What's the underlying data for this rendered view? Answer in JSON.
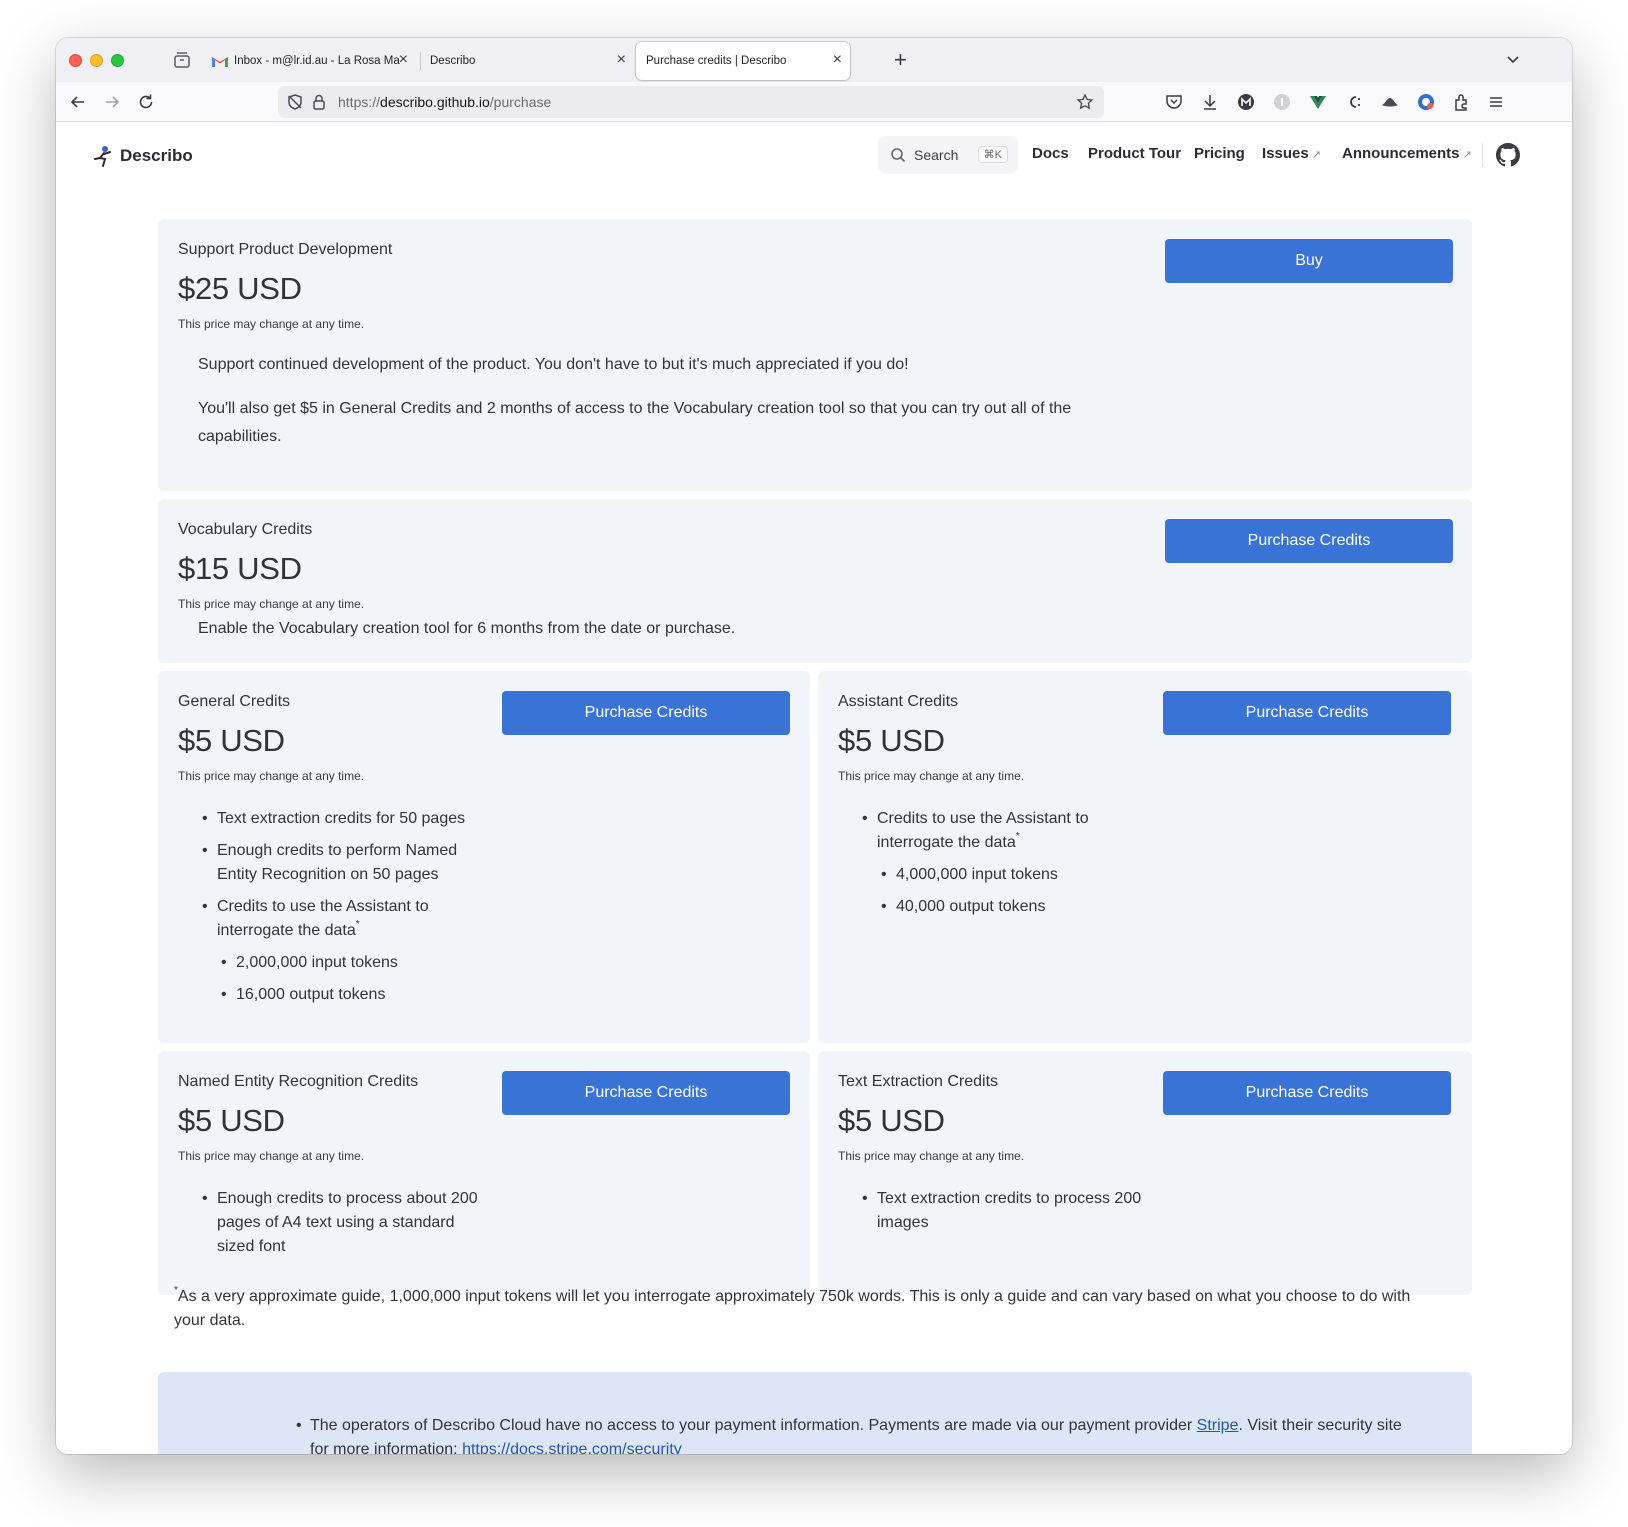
{
  "browser": {
    "tabs": [
      {
        "title": "Inbox - m@lr.id.au - La Rosa Ma",
        "active": false
      },
      {
        "title": "Describo",
        "active": false
      },
      {
        "title": "Purchase credits | Describo",
        "active": true
      }
    ],
    "url_host": "describo.github.io",
    "url_prefix": "https://",
    "url_path": "/purchase"
  },
  "site": {
    "name": "Describo",
    "search_label": "Search",
    "search_shortcut": "⌘K",
    "nav": [
      {
        "label": "Docs",
        "external": false
      },
      {
        "label": "Product Tour",
        "external": false
      },
      {
        "label": "Pricing",
        "external": false
      },
      {
        "label": "Issues",
        "external": true
      },
      {
        "label": "Announcements",
        "external": true
      }
    ],
    "external_mark": "↗"
  },
  "price_note": "This price may change at any time.",
  "products": {
    "support": {
      "label": "Support Product Development",
      "price": "$25 USD",
      "button": "Buy",
      "paragraphs": [
        "Support continued development of the product. You don't have to but it's much appreciated if you do!",
        "You'll also get $5 in General Credits and 2 months of access to the Vocabulary creation tool so that you can try out all of the capabilities."
      ]
    },
    "vocabulary": {
      "label": "Vocabulary Credits",
      "price": "$15 USD",
      "button": "Purchase Credits",
      "description": "Enable the Vocabulary creation tool for 6 months from the date or purchase."
    },
    "general": {
      "label": "General Credits",
      "price": "$5 USD",
      "button": "Purchase Credits",
      "bullets": [
        "Text extraction credits for 50 pages",
        "Enough credits to perform Named Entity Recognition on 50 pages",
        "Credits to use the Assistant to interrogate the data"
      ],
      "sub_bullets": [
        "2,000,000 input tokens",
        "16,000 output tokens"
      ]
    },
    "assistant": {
      "label": "Assistant Credits",
      "price": "$5 USD",
      "button": "Purchase Credits",
      "bullets": [
        "Credits to use the Assistant to interrogate the data"
      ],
      "sub_bullets": [
        "4,000,000 input tokens",
        "40,000 output tokens"
      ]
    },
    "ner": {
      "label": "Named Entity Recognition Credits",
      "price": "$5 USD",
      "button": "Purchase Credits",
      "bullets": [
        "Enough credits to process about 200 pages of A4 text using a standard sized font"
      ]
    },
    "text_extraction": {
      "label": "Text Extraction Credits",
      "price": "$5 USD",
      "button": "Purchase Credits",
      "bullets": [
        "Text extraction credits to process 200 images"
      ]
    }
  },
  "footnote": {
    "mark": "*",
    "text": "As a very approximate guide, 1,000,000 input tokens will let you interrogate approximately 750k words. This is only a guide and can vary based on what you choose to do with your data."
  },
  "info": {
    "text_before": "The operators of Describo Cloud have no access to your payment information. Payments are made via our payment provider ",
    "stripe_link": "Stripe",
    "text_middle": ". Visit their security site for more information: ",
    "security_link": "https://docs.stripe.com/security"
  },
  "colors": {
    "accent": "#3a73d6",
    "card_bg": "#f1f4f9",
    "info_bg": "#dce6f6"
  }
}
